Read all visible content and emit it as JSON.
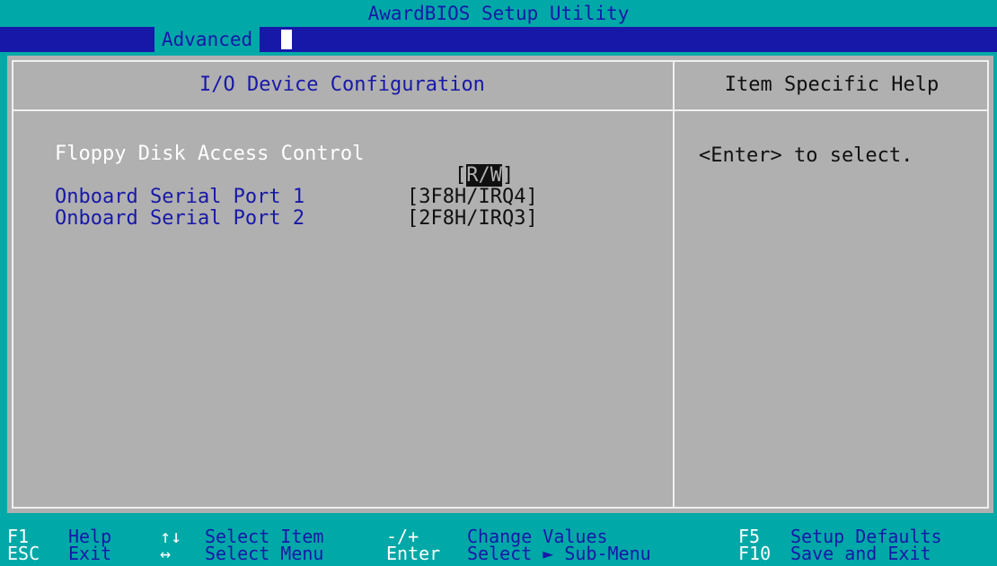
{
  "title": "AwardBIOS Setup Utility",
  "menu": {
    "active_tab": "Advanced"
  },
  "panel": {
    "header": "I/O Device Configuration",
    "help_header": "Item Specific Help",
    "items": [
      {
        "label": "Floppy Disk Access Control",
        "open": "[",
        "value": "R/W",
        "close": "]",
        "selected": true
      },
      {
        "label": "Onboard Serial Port 1",
        "value": "[3F8H/IRQ4]",
        "selected": false
      },
      {
        "label": "Onboard Serial Port 2",
        "value": "[2F8H/IRQ3]",
        "selected": false
      }
    ],
    "help_text": "<Enter> to select."
  },
  "status_bar": {
    "items": [
      {
        "key": "F1",
        "desc": "Help"
      },
      {
        "key": "ESC",
        "desc": "Exit"
      },
      {
        "key": "↑↓",
        "desc": "Select Item"
      },
      {
        "key": "↔",
        "desc": "Select Menu"
      },
      {
        "key": "-/+",
        "desc": "Change Values"
      },
      {
        "key": "Enter",
        "desc": "Select ► Sub-Menu"
      },
      {
        "key": "F5",
        "desc": "Setup Defaults"
      },
      {
        "key": "F10",
        "desc": "Save and Exit"
      }
    ]
  },
  "colors": {
    "background": "#00a8a8",
    "menu_bar": "#1818a8",
    "panel": "#b0b0b0",
    "label": "#1818a8",
    "selected_label": "#ffffff"
  }
}
